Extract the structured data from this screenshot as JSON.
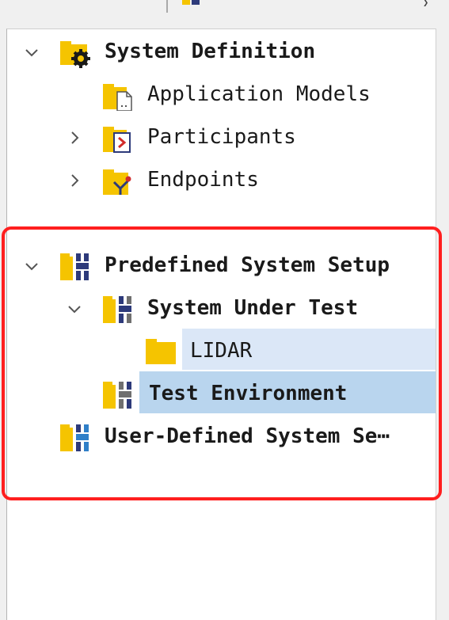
{
  "tree": {
    "system_definition": {
      "label": "System Definition",
      "expanded": true,
      "icon": "folder-gear-icon",
      "children": [
        {
          "label": "Application Models",
          "icon": "folder-document-icon"
        },
        {
          "label": "Participants",
          "icon": "folder-participant-icon",
          "expandable": true
        },
        {
          "label": "Endpoints",
          "icon": "folder-endpoint-icon",
          "expandable": true
        }
      ]
    },
    "predefined_system_setup": {
      "label": "Predefined System Setup",
      "expanded": true,
      "icon": "folder-system-setup-icon",
      "system_under_test": {
        "label": "System Under Test",
        "expanded": true,
        "icon": "folder-system-setup-icon",
        "children": [
          {
            "label": "LIDAR",
            "icon": "folder-icon",
            "selected": true
          }
        ]
      },
      "test_environment": {
        "label": "Test Environment",
        "icon": "folder-system-setup-icon",
        "selected": true
      }
    },
    "user_defined_system_setup": {
      "label": "User-Defined System Se⋯",
      "icon": "folder-system-setup-icon"
    }
  },
  "colors": {
    "folder": "#f5c400",
    "system_icon": "#2d3a7a",
    "highlight_border": "#ff1f1f",
    "selection_primary": "#b9d5ee",
    "selection_secondary": "#dbe7f7"
  }
}
